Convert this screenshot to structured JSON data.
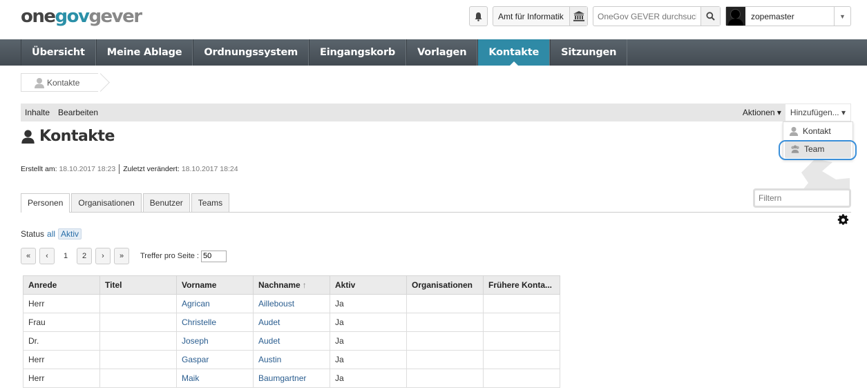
{
  "header": {
    "logo": {
      "part1": "one",
      "part2": "gov",
      "part3": "gever"
    },
    "notifications_icon": "bell-icon",
    "org_selector": "Amt für Informatik",
    "search_placeholder": "OneGov GEVER durchsuchen",
    "user_name": "zopemaster"
  },
  "nav": {
    "tabs": [
      "Übersicht",
      "Meine Ablage",
      "Ordnungssystem",
      "Eingangskorb",
      "Vorlagen",
      "Kontakte",
      "Sitzungen"
    ],
    "active": "Kontakte"
  },
  "breadcrumb": {
    "label": "Kontakte"
  },
  "editbar": {
    "contents": "Inhalte",
    "edit": "Bearbeiten",
    "actions": "Aktionen ▾",
    "add": "Hinzufügen... ▾",
    "add_menu": [
      "Kontakt",
      "Team"
    ]
  },
  "page": {
    "title": "Kontakte",
    "created_label": "Erstellt am:",
    "created_value": "18.10.2017 18:23",
    "modified_label": "Zuletzt verändert:",
    "modified_value": "18.10.2017 18:24"
  },
  "tabs": {
    "items": [
      "Personen",
      "Organisationen",
      "Benutzer",
      "Teams"
    ],
    "active": "Personen"
  },
  "filter": {
    "placeholder": "Filtern"
  },
  "status": {
    "label": "Status",
    "all": "all",
    "active": "Aktiv"
  },
  "pagination": {
    "first": "«",
    "prev": "‹",
    "pages": [
      "1",
      "2"
    ],
    "current": "1",
    "next": "›",
    "last": "»",
    "per_page_label": "Treffer pro Seite :",
    "per_page_value": "50"
  },
  "table": {
    "columns": [
      "Anrede",
      "Titel",
      "Vorname",
      "Nachname",
      "Aktiv",
      "Organisationen",
      "Frühere Konta..."
    ],
    "sort_column": "Nachname",
    "rows": [
      [
        "Herr",
        "",
        "Agrican",
        "Ailleboust",
        "Ja",
        "",
        ""
      ],
      [
        "Frau",
        "",
        "Christelle",
        "Audet",
        "Ja",
        "",
        ""
      ],
      [
        "Dr.",
        "",
        "Joseph",
        "Audet",
        "Ja",
        "",
        ""
      ],
      [
        "Herr",
        "",
        "Gaspar",
        "Austin",
        "Ja",
        "",
        ""
      ],
      [
        "Herr",
        "",
        "Maik",
        "Baumgartner",
        "Ja",
        "",
        ""
      ]
    ]
  },
  "colors": {
    "nav_bg": "#4b545b",
    "nav_active": "#2f8aa6",
    "link": "#2a5d8f",
    "focus_ring": "#3a8fd9"
  }
}
